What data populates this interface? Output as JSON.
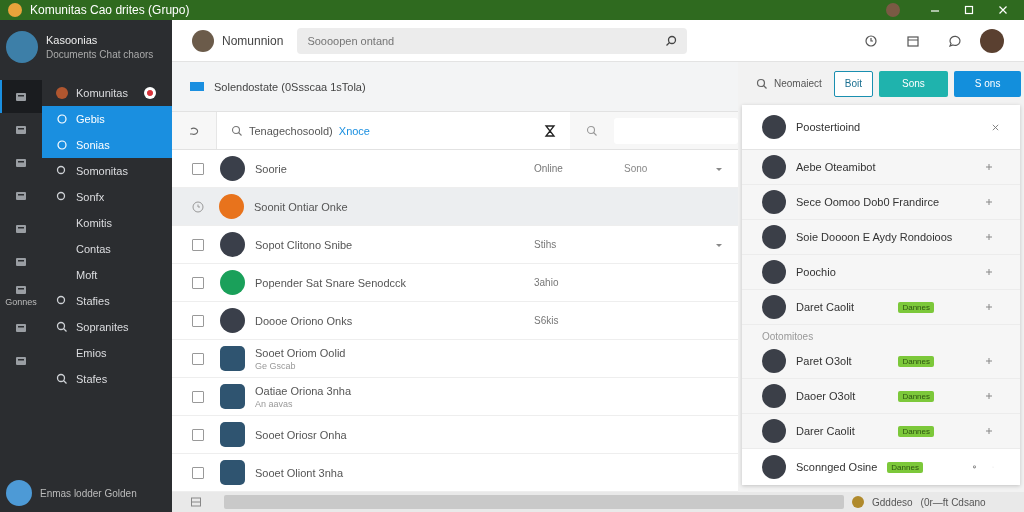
{
  "window": {
    "title": "Komunitas Cao drites (Grupo)"
  },
  "profile": {
    "name": "Kasoonias",
    "subtitle": "Documents Chat chaors"
  },
  "rail": [
    {
      "selected": true
    },
    {
      "selected": false
    },
    {
      "selected": false
    },
    {
      "selected": false
    },
    {
      "selected": false
    },
    {
      "selected": false
    },
    {
      "label": "Gonnes",
      "selected": false
    },
    {
      "selected": false
    },
    {
      "selected": false
    }
  ],
  "nav": [
    {
      "label": "Komunitas",
      "badge": true,
      "selected": false,
      "children": [
        {
          "label": "Gebis",
          "selected": true
        },
        {
          "label": "Sonias",
          "selected": true
        }
      ]
    },
    {
      "label": "Somonitas",
      "selected": false
    },
    {
      "label": "Sonfx",
      "selected": false,
      "children": [
        {
          "label": "Komitis",
          "selected": false
        },
        {
          "label": "Contas",
          "selected": false
        },
        {
          "label": "Moft",
          "selected": false
        }
      ]
    },
    {
      "label": "Stafies",
      "selected": false
    },
    {
      "label": "Sopranites",
      "selected": false,
      "children": [
        {
          "label": "Emios",
          "selected": false
        }
      ]
    },
    {
      "label": "Stafes",
      "selected": false
    }
  ],
  "footer_user": {
    "name": "Enmas lodder Golden"
  },
  "header": {
    "user": "Nomunnion",
    "search": {
      "placeholder": "Soooopen ontand"
    }
  },
  "subheader": {
    "title": "Solendostate (0Ssscaa 1sTola)"
  },
  "filter": {
    "query": "Tenagechosoold)",
    "link": "Xnoce"
  },
  "rows": [
    {
      "kind": "check",
      "checked": false,
      "selected": false,
      "name": "Soorie",
      "status": "Online",
      "extra": "Sono",
      "chevron": true
    },
    {
      "kind": "clock",
      "selected": true,
      "color": "#e8731c",
      "name": "Soonit Ontiar Onke"
    },
    {
      "kind": "check",
      "checked": false,
      "selected": false,
      "name": "Sopot Clitono Snibe",
      "status": "Stihs",
      "chevron": true
    },
    {
      "kind": "check",
      "checked": false,
      "selected": false,
      "color": "#1aa05a",
      "name": "Popender Sat Snare Senodcck",
      "status": "3ahio"
    },
    {
      "kind": "check",
      "checked": false,
      "selected": false,
      "name": "Doooe Oriono Onks",
      "status": "S6kis"
    },
    {
      "kind": "check",
      "checked": false,
      "selected": false,
      "name": "Sooet Oriom Oolid",
      "sub": "Ge Gscab"
    },
    {
      "kind": "check",
      "checked": false,
      "selected": false,
      "name": "Oatiae Oriona 3nha",
      "sub": "An aavas"
    },
    {
      "kind": "check",
      "checked": false,
      "selected": false,
      "name": "Sooet Oriosr Onha"
    },
    {
      "kind": "check",
      "checked": false,
      "selected": false,
      "name": "Sooet Oliont 3nha"
    }
  ],
  "right": {
    "search": "Neomaiect",
    "buttons": [
      {
        "label": "Boit",
        "kind": "outline"
      },
      {
        "label": "Sons",
        "kind": "teal"
      },
      {
        "label": "S ons",
        "kind": "primary"
      }
    ],
    "card": {
      "title": "Poostertioind",
      "sections": [
        {
          "items": [
            {
              "name": "Aebe Oteamibot"
            },
            {
              "name": "Sece Oomoo Dob0 Frandirce"
            },
            {
              "name": "Soie Doooon E Aydy Rondoioos"
            },
            {
              "name": "Poochio"
            },
            {
              "name": "Daret Caolit",
              "badge": "Dannes"
            }
          ]
        },
        {
          "title": "Ootomitoes",
          "items": [
            {
              "name": "Paret O3olt",
              "badge": "Dannes"
            },
            {
              "name": "Daoer O3olt",
              "badge": "Dannes"
            },
            {
              "name": "Darer Caolit",
              "badge": "Dannes"
            }
          ]
        }
      ],
      "footer": {
        "name": "Sconnged Osine",
        "badge": "Dannes"
      }
    }
  },
  "status_bar": {
    "label": "Gdddeso",
    "detail": "(0r—ft Cdsano"
  }
}
